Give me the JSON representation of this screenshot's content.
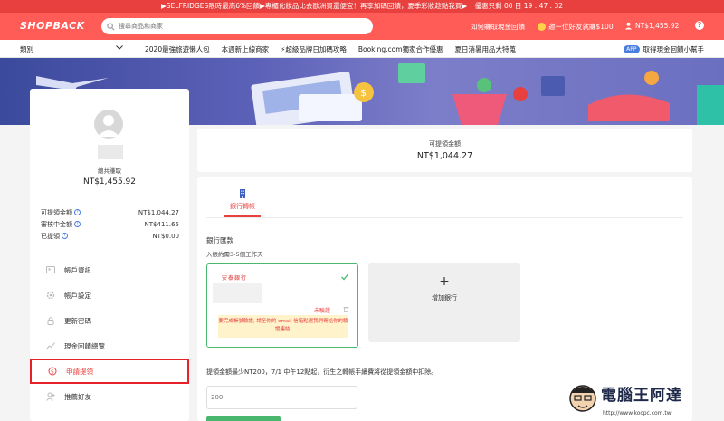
{
  "promo": {
    "text": "▶SELFRIDGES限時最高6%回饋▶專櫃化妝品比去歐洲買還便宜！再享加碼回饋，夏季彩妝趁點我買▶",
    "timer": "優惠只剩 00 日 19 : 47 : 32"
  },
  "header": {
    "logo": "SHOPBACK",
    "search_placeholder": "搜尋商品和商家",
    "how_to": "如何賺取現金回饋",
    "invite": "邀一位好友就賺$100",
    "balance": "NT$1,455.92",
    "help": "?"
  },
  "nav": {
    "category": "類別",
    "items": [
      "2020最強旅遊懶人包",
      "本週新上線商家",
      "⚡超級品牌日加碼攻略",
      "Booking.com獨家合作優惠",
      "夏日消暑用品大特蒐"
    ],
    "app_pill": "APP",
    "app_link": "取得現金回饋小幫手"
  },
  "sidebar": {
    "total_label": "總共賺取",
    "total_value": "NT$1,455.92",
    "stats": [
      {
        "label": "可提領金額",
        "value": "NT$1,044.27",
        "help": true
      },
      {
        "label": "審核中金額",
        "value": "NT$411.65",
        "help": true
      },
      {
        "label": "已提領",
        "value": "NT$0.00",
        "help": true
      }
    ],
    "menu": [
      {
        "label": "帳戶資訊",
        "icon": "user-card-icon"
      },
      {
        "label": "帳戶設定",
        "icon": "gear-icon"
      },
      {
        "label": "更新密碼",
        "icon": "lock-icon"
      },
      {
        "label": "現金回饋總覽",
        "icon": "chart-icon"
      },
      {
        "label": "申請提領",
        "icon": "withdraw-icon",
        "active": true
      },
      {
        "label": "推薦好友",
        "icon": "add-friend-icon"
      }
    ]
  },
  "balance_card": {
    "label": "可提領金額",
    "value": "NT$1,044.27"
  },
  "main": {
    "tab_label": "銀行轉帳",
    "section_title": "銀行匯款",
    "section_sub": "入帳約需3-5個工作天",
    "bank_logo": "安泰銀行",
    "unverified": "未驗證",
    "warning": "要完成帳號驗證, 請至你的 email 信箱點選我們寄給你的驗證連結.",
    "add_bank": "增加銀行",
    "add_plus": "+",
    "notice": "提領金額最少NT200，7/1 中午12點起，衍生之轉帳手續費將從提領金額中扣除。",
    "amount_placeholder": "200"
  },
  "watermark": {
    "text": "電腦王阿達",
    "url": "http://www.kocpc.com.tw"
  },
  "colors": {
    "brand": "#ff5b57",
    "promo": "#e8403e",
    "success": "#49b86e",
    "link": "#4a7de0"
  }
}
